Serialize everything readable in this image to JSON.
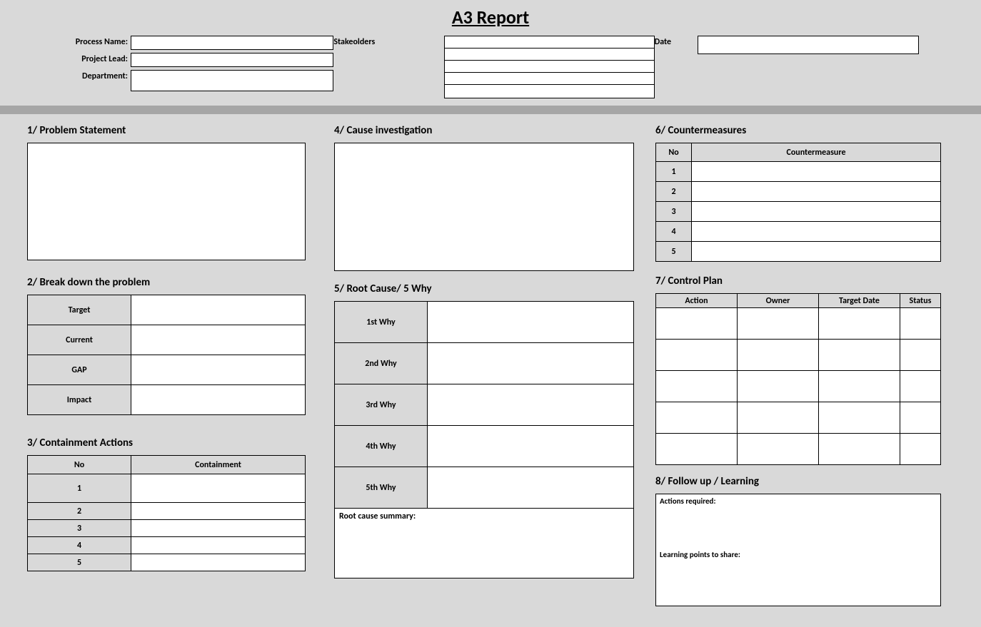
{
  "title": "A3 Report",
  "header": {
    "process_name_label": "Process Name:",
    "project_lead_label": "Project Lead:",
    "department_label": "Department:",
    "stakeholders_label": "Stakeolders",
    "date_label": "Date"
  },
  "sections": {
    "s1": "1/ Problem Statement",
    "s2": "2/ Break down the problem",
    "s3": "3/ Containment Actions",
    "s4": "4/ Cause investigation",
    "s5": "5/ Root Cause/ 5 Why",
    "s6": "6/ Countermeasures",
    "s7": "7/ Control Plan",
    "s8": "8/ Follow up / Learning"
  },
  "breakdown": {
    "target": "Target",
    "current": "Current",
    "gap": "GAP",
    "impact": "Impact"
  },
  "containment": {
    "no": "No",
    "containment": "Containment",
    "rows": [
      "1",
      "2",
      "3",
      "4",
      "5"
    ]
  },
  "why": {
    "w1": "1st Why",
    "w2": "2nd Why",
    "w3": "3rd Why",
    "w4": "4th Why",
    "w5": "5th Why",
    "root_summary": "Root cause summary:"
  },
  "countermeasures": {
    "no": "No",
    "cm": "Countermeasure",
    "rows": [
      "1",
      "2",
      "3",
      "4",
      "5"
    ]
  },
  "control_plan": {
    "action": "Action",
    "owner": "Owner",
    "target_date": "Target Date",
    "status": "Status"
  },
  "followup": {
    "actions_required": "Actions required:",
    "learning_points": "Learning points to share:"
  }
}
